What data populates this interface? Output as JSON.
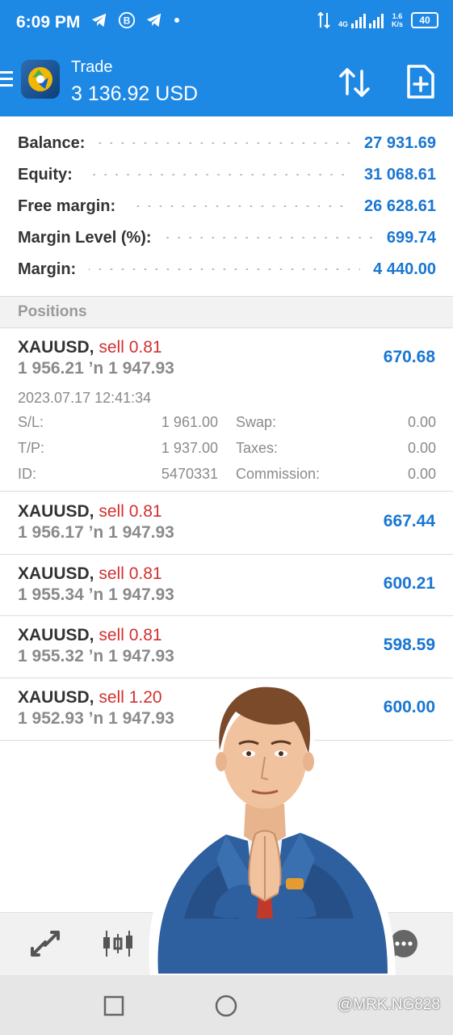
{
  "status": {
    "time": "6:09 PM",
    "net_type": "4G",
    "speed_value": "1.6",
    "speed_unit": "K/s",
    "battery": "40"
  },
  "header": {
    "title": "Trade",
    "balance": "3 136.92 USD"
  },
  "summary": {
    "balance_label": "Balance:",
    "balance_value": "27 931.69",
    "equity_label": "Equity:",
    "equity_value": "31 068.61",
    "free_margin_label": "Free margin:",
    "free_margin_value": "26 628.61",
    "margin_level_label": "Margin Level (%):",
    "margin_level_value": "699.74",
    "margin_label": "Margin:",
    "margin_value": "4 440.00"
  },
  "positions_header": "Positions",
  "positions": [
    {
      "symbol": "XAUUSD,",
      "side": "sell 0.81",
      "prices": "1 956.21 ’n 1 947.93",
      "profit": "670.68",
      "time": "2023.07.17 12:41:34",
      "sl_label": "S/L:",
      "sl": "1 961.00",
      "swap_label": "Swap:",
      "swap": "0.00",
      "tp_label": "T/P:",
      "tp": "1 937.00",
      "taxes_label": "Taxes:",
      "taxes": "0.00",
      "id_label": "ID:",
      "id": "5470331",
      "commission_label": "Commission:",
      "commission": "0.00"
    },
    {
      "symbol": "XAUUSD,",
      "side": "sell 0.81",
      "prices": "1 956.17 ’n 1 947.93",
      "profit": "667.44"
    },
    {
      "symbol": "XAUUSD,",
      "side": "sell 0.81",
      "prices": "1 955.34 ’n 1 947.93",
      "profit": "600.21"
    },
    {
      "symbol": "XAUUSD,",
      "side": "sell 0.81",
      "prices": "1 955.32 ’n 1 947.93",
      "profit": "598.59"
    },
    {
      "symbol": "XAUUSD,",
      "side": "sell 1.20",
      "prices": "1 952.93 ’n 1 947.93",
      "profit": "600.00"
    }
  ],
  "watermark": "@MRK.NG828",
  "colors": {
    "header_bg": "#1e88e5",
    "value_blue": "#1976d2",
    "sell_red": "#d32f2f"
  },
  "icons": [
    "menu-icon",
    "metatrader-logo-icon",
    "sort-icon",
    "new-order-icon",
    "quotes-icon",
    "chart-icon",
    "chat-icon",
    "square-nav-icon",
    "circle-nav-icon"
  ]
}
